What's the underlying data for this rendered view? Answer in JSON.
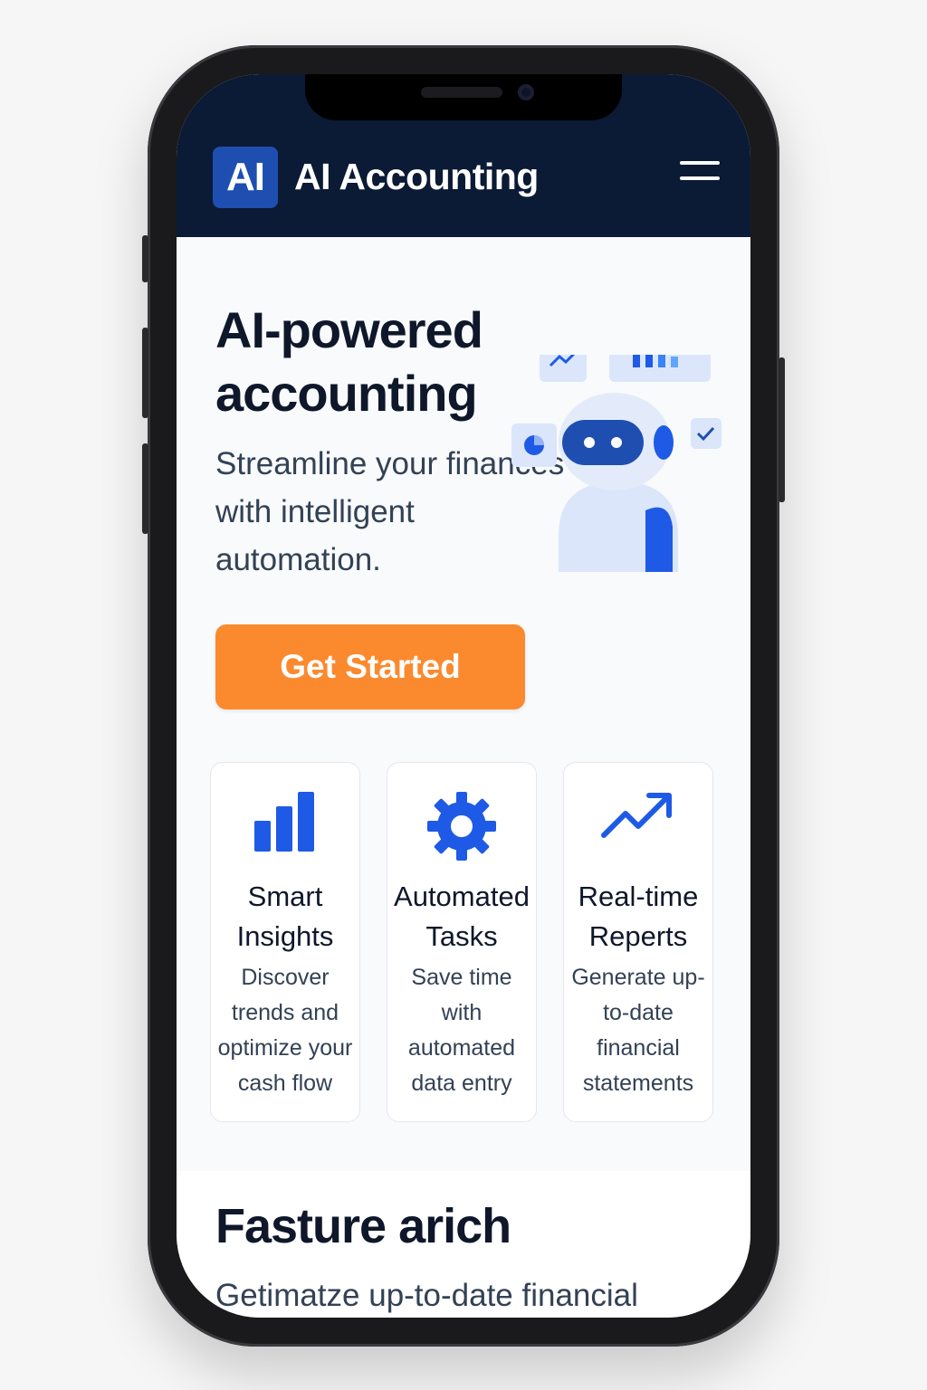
{
  "app": {
    "logo_text": "AI",
    "title": "AI Accounting"
  },
  "hero": {
    "title": "AI-powered accounting",
    "subtitle": "Streamline your finances with intelligent automation.",
    "cta_label": "Get Started"
  },
  "features": [
    {
      "icon": "bar-chart-icon",
      "title": "Smart Insights",
      "description": "Discover trends and optimize your cash flow"
    },
    {
      "icon": "gear-icon",
      "title": "Automated Tasks",
      "description": "Save time with automated data entry"
    },
    {
      "icon": "trending-up-icon",
      "title": "Real-time Reperts",
      "description": "Generate up-to-date financial statements"
    }
  ],
  "section2": {
    "title": "Fasture arich",
    "subtitle": "Getimatze up-to-date financial"
  },
  "colors": {
    "appbar": "#0b1a35",
    "accent": "#1e5ae6",
    "cta": "#fb8a2e"
  }
}
